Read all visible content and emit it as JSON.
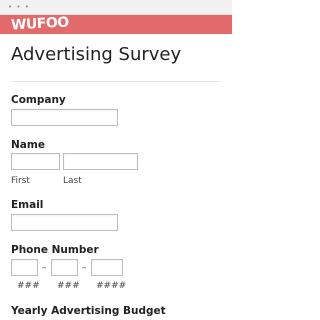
{
  "window": {
    "controls": "• • •"
  },
  "brand": {
    "logo_text": "WUFOO",
    "bar_color": "#e36a6a"
  },
  "form": {
    "title": "Advertising Survey",
    "fields": {
      "company": {
        "label": "Company",
        "value": ""
      },
      "name": {
        "label": "Name",
        "first_sublabel": "First",
        "last_sublabel": "Last",
        "first_value": "",
        "last_value": ""
      },
      "email": {
        "label": "Email",
        "value": ""
      },
      "phone": {
        "label": "Phone Number",
        "sep": "–",
        "part1_hint": "###",
        "part2_hint": "###",
        "part3_hint": "####"
      },
      "budget": {
        "label": "Yearly Advertising Budget"
      }
    }
  }
}
